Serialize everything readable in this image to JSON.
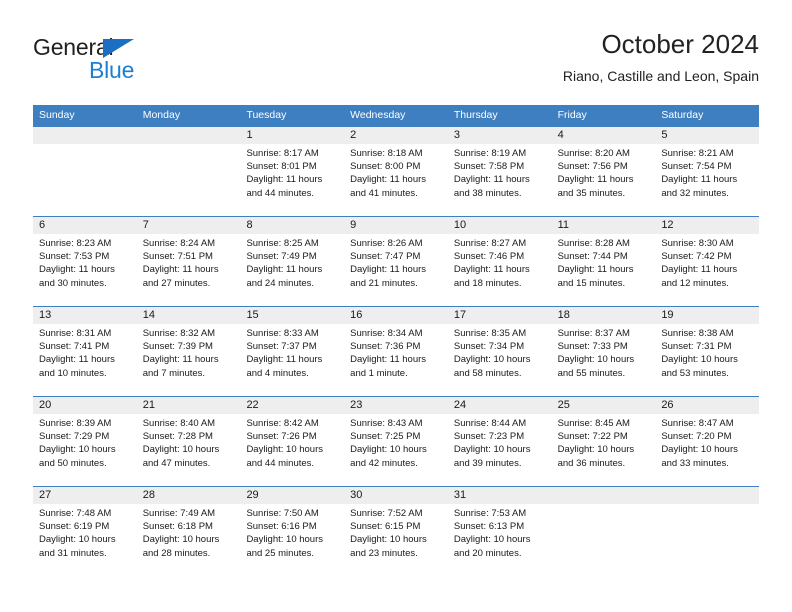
{
  "logo": {
    "word1": "General",
    "word2": "Blue",
    "triangle_color": "#1b6ec2",
    "blue_color": "#1b7fd4"
  },
  "header": {
    "title": "October 2024",
    "subtitle": "Riano, Castille and Leon, Spain"
  },
  "calendar": {
    "header_bg": "#3e7fc1",
    "daynum_bg": "#eeeeee",
    "weekdays": [
      "Sunday",
      "Monday",
      "Tuesday",
      "Wednesday",
      "Thursday",
      "Friday",
      "Saturday"
    ],
    "weeks": [
      [
        {
          "day": "",
          "l1": "",
          "l2": "",
          "l3": "",
          "l4": ""
        },
        {
          "day": "",
          "l1": "",
          "l2": "",
          "l3": "",
          "l4": ""
        },
        {
          "day": "1",
          "l1": "Sunrise: 8:17 AM",
          "l2": "Sunset: 8:01 PM",
          "l3": "Daylight: 11 hours",
          "l4": "and 44 minutes."
        },
        {
          "day": "2",
          "l1": "Sunrise: 8:18 AM",
          "l2": "Sunset: 8:00 PM",
          "l3": "Daylight: 11 hours",
          "l4": "and 41 minutes."
        },
        {
          "day": "3",
          "l1": "Sunrise: 8:19 AM",
          "l2": "Sunset: 7:58 PM",
          "l3": "Daylight: 11 hours",
          "l4": "and 38 minutes."
        },
        {
          "day": "4",
          "l1": "Sunrise: 8:20 AM",
          "l2": "Sunset: 7:56 PM",
          "l3": "Daylight: 11 hours",
          "l4": "and 35 minutes."
        },
        {
          "day": "5",
          "l1": "Sunrise: 8:21 AM",
          "l2": "Sunset: 7:54 PM",
          "l3": "Daylight: 11 hours",
          "l4": "and 32 minutes."
        }
      ],
      [
        {
          "day": "6",
          "l1": "Sunrise: 8:23 AM",
          "l2": "Sunset: 7:53 PM",
          "l3": "Daylight: 11 hours",
          "l4": "and 30 minutes."
        },
        {
          "day": "7",
          "l1": "Sunrise: 8:24 AM",
          "l2": "Sunset: 7:51 PM",
          "l3": "Daylight: 11 hours",
          "l4": "and 27 minutes."
        },
        {
          "day": "8",
          "l1": "Sunrise: 8:25 AM",
          "l2": "Sunset: 7:49 PM",
          "l3": "Daylight: 11 hours",
          "l4": "and 24 minutes."
        },
        {
          "day": "9",
          "l1": "Sunrise: 8:26 AM",
          "l2": "Sunset: 7:47 PM",
          "l3": "Daylight: 11 hours",
          "l4": "and 21 minutes."
        },
        {
          "day": "10",
          "l1": "Sunrise: 8:27 AM",
          "l2": "Sunset: 7:46 PM",
          "l3": "Daylight: 11 hours",
          "l4": "and 18 minutes."
        },
        {
          "day": "11",
          "l1": "Sunrise: 8:28 AM",
          "l2": "Sunset: 7:44 PM",
          "l3": "Daylight: 11 hours",
          "l4": "and 15 minutes."
        },
        {
          "day": "12",
          "l1": "Sunrise: 8:30 AM",
          "l2": "Sunset: 7:42 PM",
          "l3": "Daylight: 11 hours",
          "l4": "and 12 minutes."
        }
      ],
      [
        {
          "day": "13",
          "l1": "Sunrise: 8:31 AM",
          "l2": "Sunset: 7:41 PM",
          "l3": "Daylight: 11 hours",
          "l4": "and 10 minutes."
        },
        {
          "day": "14",
          "l1": "Sunrise: 8:32 AM",
          "l2": "Sunset: 7:39 PM",
          "l3": "Daylight: 11 hours",
          "l4": "and 7 minutes."
        },
        {
          "day": "15",
          "l1": "Sunrise: 8:33 AM",
          "l2": "Sunset: 7:37 PM",
          "l3": "Daylight: 11 hours",
          "l4": "and 4 minutes."
        },
        {
          "day": "16",
          "l1": "Sunrise: 8:34 AM",
          "l2": "Sunset: 7:36 PM",
          "l3": "Daylight: 11 hours",
          "l4": "and 1 minute."
        },
        {
          "day": "17",
          "l1": "Sunrise: 8:35 AM",
          "l2": "Sunset: 7:34 PM",
          "l3": "Daylight: 10 hours",
          "l4": "and 58 minutes."
        },
        {
          "day": "18",
          "l1": "Sunrise: 8:37 AM",
          "l2": "Sunset: 7:33 PM",
          "l3": "Daylight: 10 hours",
          "l4": "and 55 minutes."
        },
        {
          "day": "19",
          "l1": "Sunrise: 8:38 AM",
          "l2": "Sunset: 7:31 PM",
          "l3": "Daylight: 10 hours",
          "l4": "and 53 minutes."
        }
      ],
      [
        {
          "day": "20",
          "l1": "Sunrise: 8:39 AM",
          "l2": "Sunset: 7:29 PM",
          "l3": "Daylight: 10 hours",
          "l4": "and 50 minutes."
        },
        {
          "day": "21",
          "l1": "Sunrise: 8:40 AM",
          "l2": "Sunset: 7:28 PM",
          "l3": "Daylight: 10 hours",
          "l4": "and 47 minutes."
        },
        {
          "day": "22",
          "l1": "Sunrise: 8:42 AM",
          "l2": "Sunset: 7:26 PM",
          "l3": "Daylight: 10 hours",
          "l4": "and 44 minutes."
        },
        {
          "day": "23",
          "l1": "Sunrise: 8:43 AM",
          "l2": "Sunset: 7:25 PM",
          "l3": "Daylight: 10 hours",
          "l4": "and 42 minutes."
        },
        {
          "day": "24",
          "l1": "Sunrise: 8:44 AM",
          "l2": "Sunset: 7:23 PM",
          "l3": "Daylight: 10 hours",
          "l4": "and 39 minutes."
        },
        {
          "day": "25",
          "l1": "Sunrise: 8:45 AM",
          "l2": "Sunset: 7:22 PM",
          "l3": "Daylight: 10 hours",
          "l4": "and 36 minutes."
        },
        {
          "day": "26",
          "l1": "Sunrise: 8:47 AM",
          "l2": "Sunset: 7:20 PM",
          "l3": "Daylight: 10 hours",
          "l4": "and 33 minutes."
        }
      ],
      [
        {
          "day": "27",
          "l1": "Sunrise: 7:48 AM",
          "l2": "Sunset: 6:19 PM",
          "l3": "Daylight: 10 hours",
          "l4": "and 31 minutes."
        },
        {
          "day": "28",
          "l1": "Sunrise: 7:49 AM",
          "l2": "Sunset: 6:18 PM",
          "l3": "Daylight: 10 hours",
          "l4": "and 28 minutes."
        },
        {
          "day": "29",
          "l1": "Sunrise: 7:50 AM",
          "l2": "Sunset: 6:16 PM",
          "l3": "Daylight: 10 hours",
          "l4": "and 25 minutes."
        },
        {
          "day": "30",
          "l1": "Sunrise: 7:52 AM",
          "l2": "Sunset: 6:15 PM",
          "l3": "Daylight: 10 hours",
          "l4": "and 23 minutes."
        },
        {
          "day": "31",
          "l1": "Sunrise: 7:53 AM",
          "l2": "Sunset: 6:13 PM",
          "l3": "Daylight: 10 hours",
          "l4": "and 20 minutes."
        },
        {
          "day": "",
          "l1": "",
          "l2": "",
          "l3": "",
          "l4": ""
        },
        {
          "day": "",
          "l1": "",
          "l2": "",
          "l3": "",
          "l4": ""
        }
      ]
    ]
  }
}
